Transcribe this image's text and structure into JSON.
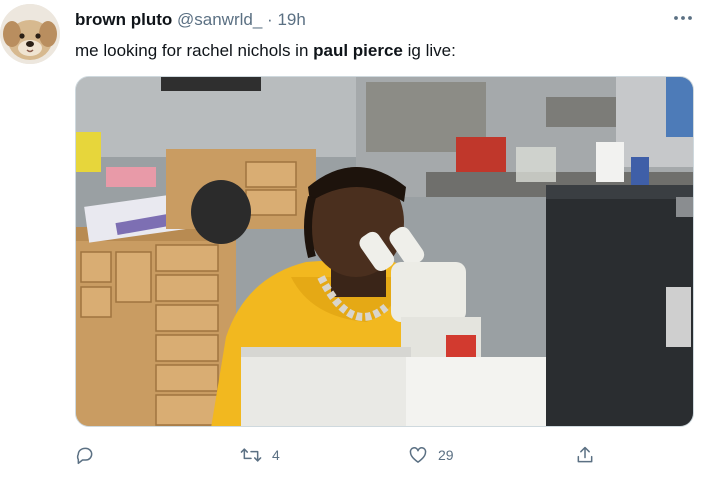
{
  "tweet": {
    "display_name": "brown pluto",
    "handle": "@sanwrld_",
    "separator": "·",
    "time": "19h",
    "text_before": "me looking for rachel nichols in ",
    "text_bold": "paul pierce",
    "text_after": " ig live:"
  },
  "media": {
    "description": "photo"
  },
  "actions": {
    "reply_icon": "reply-icon",
    "retweet_count": "4",
    "like_count": "29",
    "share_icon": "share-icon"
  },
  "colors": {
    "secondary_text": "#5b7083",
    "hoodie": "#f2b81f"
  }
}
